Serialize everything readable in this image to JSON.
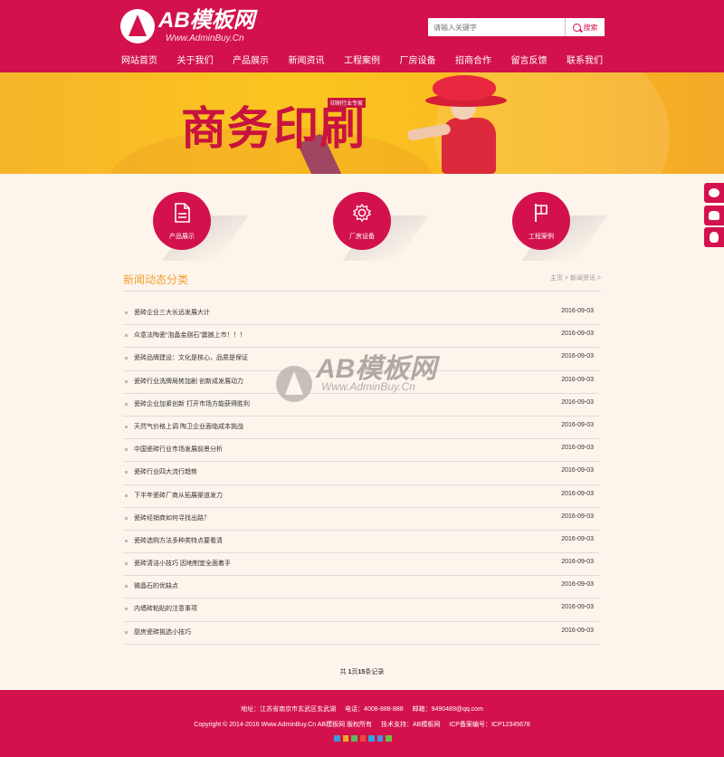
{
  "brand": {
    "logo_title": "AB模板网",
    "logo_url": "Www.AdminBuy.Cn"
  },
  "search": {
    "placeholder": "请输入关键字",
    "button_label": "搜索"
  },
  "nav": [
    "网站首页",
    "关于我们",
    "产品展示",
    "新闻资讯",
    "工程案例",
    "厂房设备",
    "招商合作",
    "留言反馈",
    "联系我们"
  ],
  "banner": {
    "title": "商务印刷",
    "tag": "印刷行业专家"
  },
  "categories": [
    {
      "label": "产品展示",
      "icon": "document-icon"
    },
    {
      "label": "厂房设备",
      "icon": "gear-icon"
    },
    {
      "label": "工程案例",
      "icon": "flag-icon"
    }
  ],
  "section": {
    "title": "新闻动态分类",
    "breadcrumb": {
      "home": "主页",
      "sep": ">",
      "current": "新闻资讯"
    }
  },
  "news": [
    {
      "title": "瓷砖企业三大长远发展大计",
      "date": "2016-09-03"
    },
    {
      "title": "众意法陶瓷“泡晶金刚石”震撼上市！！！",
      "date": "2016-09-03"
    },
    {
      "title": "瓷砖品牌建设：文化是核心，品质是保证",
      "date": "2016-09-03"
    },
    {
      "title": "瓷砖行业洗牌局势加剧 创新成发展动力",
      "date": "2016-09-03"
    },
    {
      "title": "瓷砖企业加紧创新 打开市场方能获得胜利",
      "date": "2016-09-03"
    },
    {
      "title": "天然气价格上调 陶卫企业面临成本挑战",
      "date": "2016-09-03"
    },
    {
      "title": "中国瓷砖行业市场发展前景分析",
      "date": "2016-09-03"
    },
    {
      "title": "瓷砖行业四大流行趋势",
      "date": "2016-09-03"
    },
    {
      "title": "下半年瓷砖厂商从拓展渠道发力",
      "date": "2016-09-03"
    },
    {
      "title": "瓷砖经销商如何寻找出路？",
      "date": "2016-09-03"
    },
    {
      "title": "瓷砖选购方法多种类特点要看清",
      "date": "2016-09-03"
    },
    {
      "title": "瓷砖清洁小技巧 因地制宜全面着手",
      "date": "2016-09-03"
    },
    {
      "title": "微晶石的优缺点",
      "date": "2016-09-03"
    },
    {
      "title": "内墙砖粘贴的注意事项",
      "date": "2016-09-03"
    },
    {
      "title": "厨房瓷砖挑选小技巧",
      "date": "2016-09-03"
    }
  ],
  "pager": {
    "prefix": "共 ",
    "pages": "1",
    "mid": "页",
    "records": "15",
    "suffix": "条记录"
  },
  "watermark": {
    "title": "AB模板网",
    "url": "Www.AdminBuy.Cn"
  },
  "side_icons": [
    "chat-icon",
    "user-group-icon",
    "qq-icon"
  ],
  "footer": {
    "address": "地址：江苏省南京市玄武区玄武湖",
    "phone": "电话：4008-888-888",
    "email": "邮箱：9490489@qq.com",
    "copyright": "Copyright © 2014-2016 Www.AdminBuy.Cn AB模板网 版权所有",
    "support": "技术支持：AB模板网",
    "icp": "ICP备案编号：ICP12345678",
    "share_colors": [
      "#3b9bd6",
      "#f5a623",
      "#5cb85c",
      "#e94b3c",
      "#2ea7e0",
      "#4a90e2",
      "#6dbf3f"
    ]
  },
  "colors": {
    "brand": "#d3124d",
    "accent": "#f0a030",
    "background": "#fdf5ec"
  }
}
